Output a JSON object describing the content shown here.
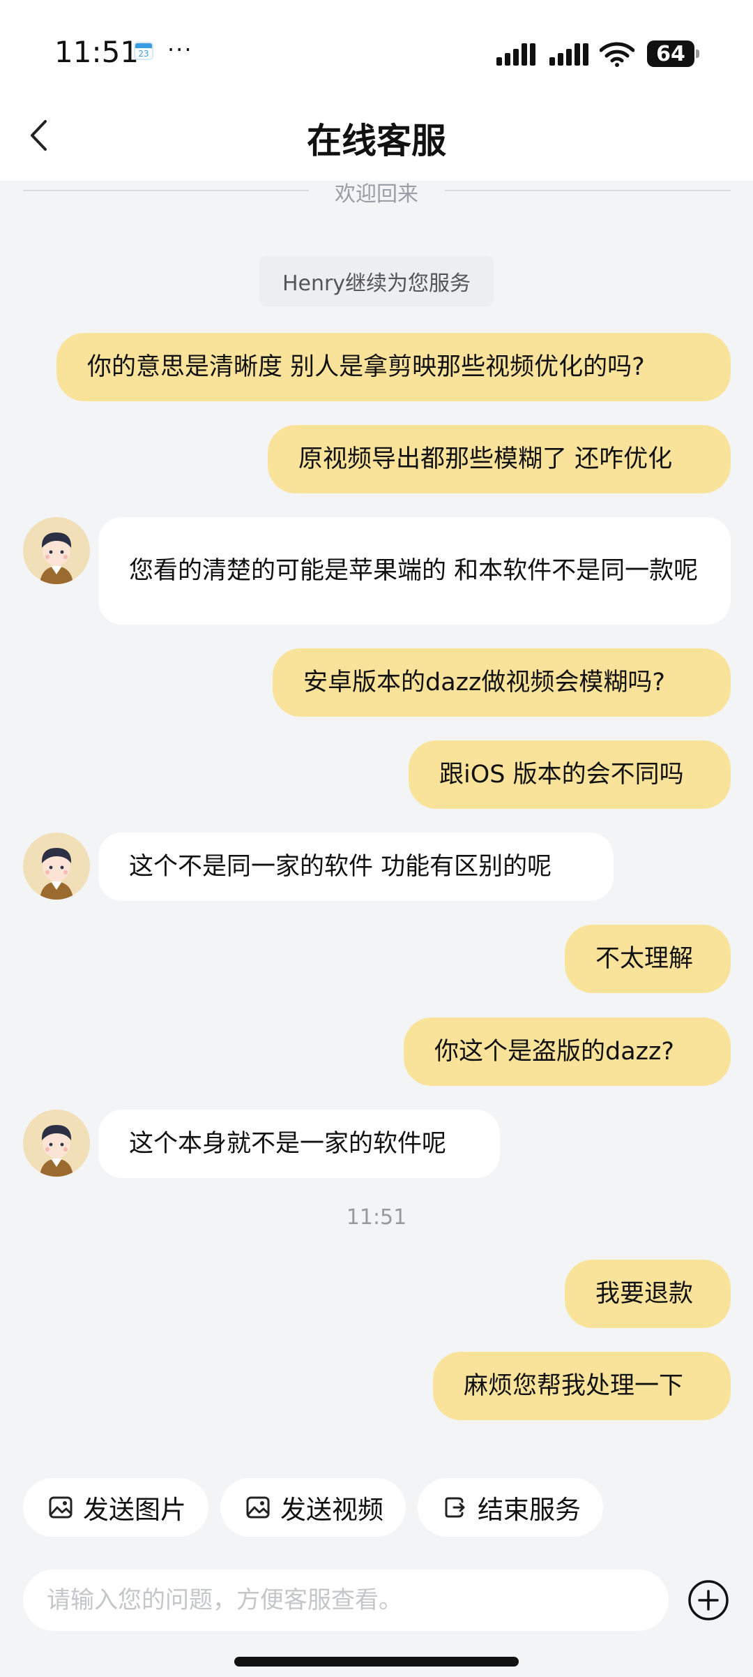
{
  "status_bar": {
    "time": "11:51",
    "calendar_day": "23",
    "more": "···",
    "battery": "64"
  },
  "header": {
    "title": "在线客服"
  },
  "divider": {
    "text": "欢迎回来"
  },
  "service_tag": "Henry继续为您服务",
  "messages": [
    {
      "from": "me",
      "text": "你的意思是清晰度 别人是拿剪映那些视频优化的吗?"
    },
    {
      "from": "me",
      "text": "原视频导出都那些模糊了 还咋优化"
    },
    {
      "from": "agent",
      "text": "您看的清楚的可能是苹果端的 和本软件不是同一款呢"
    },
    {
      "from": "me",
      "text": "安卓版本的dazz做视频会模糊吗?"
    },
    {
      "from": "me",
      "text": "跟iOS 版本的会不同吗"
    },
    {
      "from": "agent",
      "text": "这个不是同一家的软件 功能有区别的呢"
    },
    {
      "from": "me",
      "text": "不太理解"
    },
    {
      "from": "me",
      "text": "你这个是盗版的dazz?"
    },
    {
      "from": "agent",
      "text": "这个本身就不是一家的软件呢"
    },
    {
      "from": "me",
      "text": "我要退款"
    },
    {
      "from": "me",
      "text": "麻烦您帮我处理一下"
    }
  ],
  "time_separator": "11:51",
  "quick_actions": {
    "send_image": "发送图片",
    "send_video": "发送视频",
    "end_service": "结束服务"
  },
  "input": {
    "placeholder": "请输入您的问题，方便客服查看。",
    "value": ""
  },
  "colors": {
    "user_bubble": "#f9e39b",
    "agent_bubble": "#ffffff",
    "background": "#f3f4f6"
  }
}
